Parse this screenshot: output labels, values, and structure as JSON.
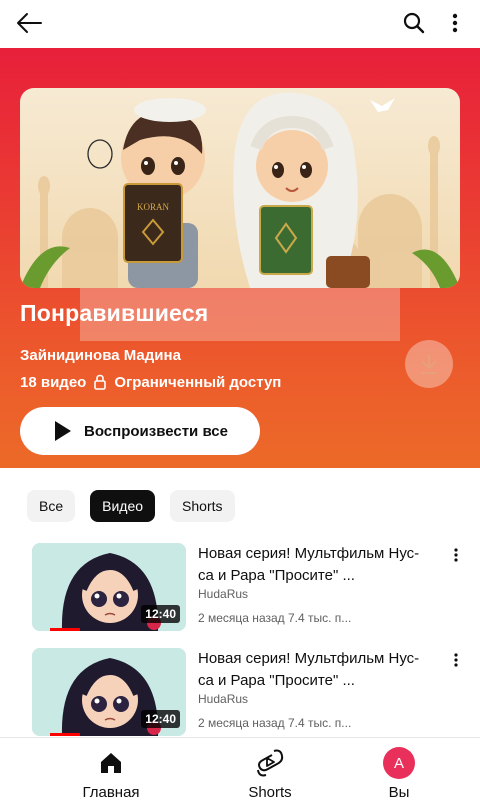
{
  "topbar": {
    "back_icon": "arrow-left-icon",
    "search_icon": "search-icon",
    "more_icon": "more-vertical-icon"
  },
  "playlist": {
    "title": "Понравившиеся",
    "owner": "Зайнидинова Мадина",
    "video_count": "18 видео",
    "privacy": "Ограниченный доступ",
    "play_all_label": "Воспроизвести все",
    "cover_book_text": "KORAN",
    "gradient_top": "#e8203a",
    "gradient_bottom": "#ec6a28"
  },
  "filters": {
    "chips": [
      {
        "label": "Все",
        "active": false
      },
      {
        "label": "Видео",
        "active": true
      },
      {
        "label": "Shorts",
        "active": false
      }
    ]
  },
  "videos": [
    {
      "title": "Новая серия! Мультфильм Нус-са и Рара \"Просите\" ...",
      "channel": "HudaRus",
      "stats": "2 месяца назад   7.4 тыс. п...",
      "duration": "12:40",
      "progress": 0.2
    },
    {
      "title": "Новая серия! Мультфильм Нус-са и Рара \"Просите\" ...",
      "channel": "HudaRus",
      "stats": "2 месяца назад   7.4 тыс. п...",
      "duration": "12:40",
      "progress": 0.2
    }
  ],
  "nav": {
    "home": "Главная",
    "shorts": "Shorts",
    "you": "Вы",
    "avatar_letter": "A",
    "avatar_color": "#e8305b"
  }
}
